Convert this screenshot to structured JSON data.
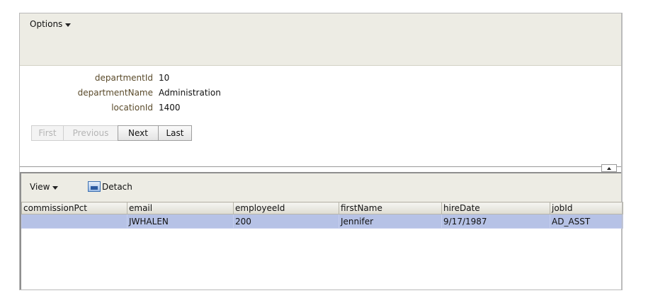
{
  "options_menu": {
    "label": "Options"
  },
  "form": {
    "fields": [
      {
        "label": "departmentId",
        "value": "10"
      },
      {
        "label": "departmentName",
        "value": "Administration"
      },
      {
        "label": "locationId",
        "value": "1400"
      }
    ],
    "nav": {
      "first": "First",
      "previous": "Previous",
      "next": "Next",
      "last": "Last"
    }
  },
  "toolbar": {
    "view_label": "View",
    "detach_label": "Detach"
  },
  "table": {
    "columns": [
      "commissionPct",
      "email",
      "employeeId",
      "firstName",
      "hireDate",
      "jobId"
    ],
    "rows": [
      [
        "",
        "JWHALEN",
        "200",
        "Jennifer",
        "9/17/1987",
        "AD_ASST"
      ]
    ]
  }
}
